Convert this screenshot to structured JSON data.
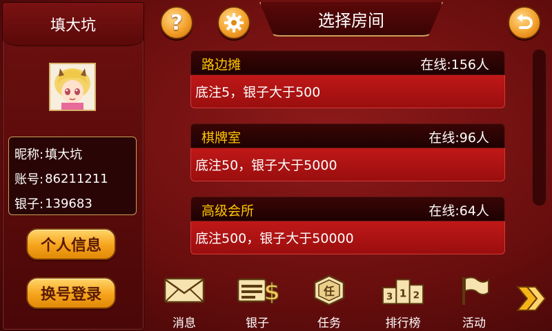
{
  "player": {
    "name": "填大坑",
    "nickname_label": "昵称:",
    "nickname": "填大坑",
    "account_label": "账号:",
    "account": "86211211",
    "silver_label": "银子:",
    "silver": "139683"
  },
  "left_buttons": {
    "profile": "个人信息",
    "switch_account": "换号登录"
  },
  "header": {
    "title": "选择房间",
    "help_icon": "help-icon",
    "settings_icon": "gear-icon",
    "back_icon": "back-icon"
  },
  "rooms": [
    {
      "name": "路边摊",
      "online": "在线:156人",
      "desc": "底注5，银子大于500"
    },
    {
      "name": "棋牌室",
      "online": "在线:96人",
      "desc": "底注50，银子大于5000"
    },
    {
      "name": "高级会所",
      "online": "在线:64人",
      "desc": "底注500，银子大于50000"
    }
  ],
  "nav": [
    {
      "label": "消息",
      "icon": "envelope-icon"
    },
    {
      "label": "银子",
      "icon": "money-icon"
    },
    {
      "label": "任务",
      "icon": "task-icon"
    },
    {
      "label": "排行榜",
      "icon": "podium-icon"
    },
    {
      "label": "活动",
      "icon": "flag-icon"
    }
  ],
  "nav_podium_digits": [
    "3",
    "1",
    "2"
  ],
  "nav_task_char": "任",
  "colors": {
    "gold": "#ffc800",
    "button_orange": "#f6a31a",
    "panel_red": "#6a0e0e"
  }
}
